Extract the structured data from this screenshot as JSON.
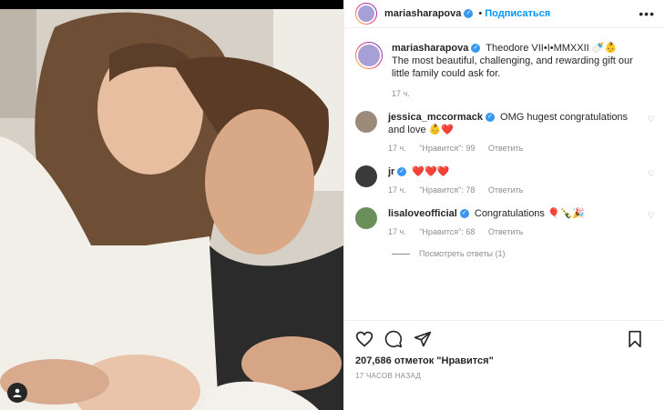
{
  "post": {
    "username": "mariasharapova",
    "follow_label": "Подписаться",
    "dot": "•",
    "more": "•••",
    "caption_title": "Theodore VII•I•MMXXII 🍼👶",
    "caption_body": "The most beautiful, challenging, and rewarding gift our little family could ask for.",
    "caption_time": "17 ч.",
    "likes": "207,686 отметок \"Нравится\"",
    "timestamp": "17 ЧАСОВ НАЗАД"
  },
  "comments": [
    {
      "username": "jessica_mccormack",
      "text": "OMG hugest congratulations and love 👶❤️",
      "time": "17 ч.",
      "likes": "\"Нравится\": 99",
      "reply": "Ответить",
      "avatar_color": "#9b8a7a"
    },
    {
      "username": "jr",
      "text": "❤️❤️❤️",
      "time": "17 ч.",
      "likes": "\"Нравится\": 78",
      "reply": "Ответить",
      "avatar_color": "#3a3a3a"
    },
    {
      "username": "lisaloveofficial",
      "text": "Congratulations 🎈🍾🎉",
      "time": "17 ч.",
      "likes": "\"Нравится\": 68",
      "reply": "Ответить",
      "avatar_color": "#6b8f5a"
    }
  ],
  "view_replies": "Посмотреть ответы (1)",
  "colors": {
    "accent": "#0095f6",
    "verified": "#3897f0",
    "muted": "#8e8e8e"
  },
  "icons": [
    "heart-icon",
    "comment-icon",
    "share-icon",
    "bookmark-icon",
    "tag-person-icon",
    "verified-icon"
  ]
}
